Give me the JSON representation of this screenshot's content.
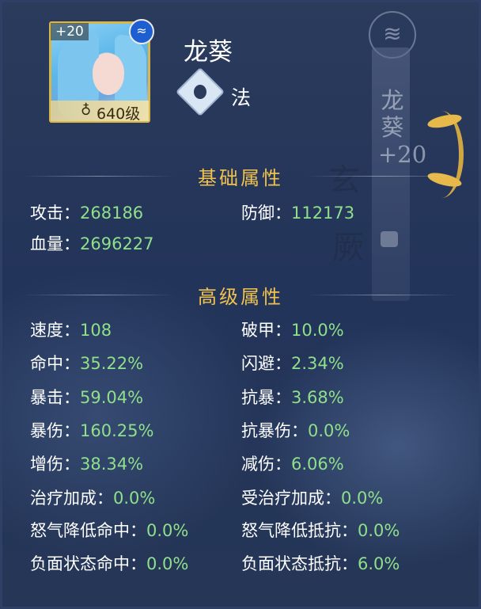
{
  "hero": {
    "name": "龙葵",
    "enhance": "+20",
    "level": "640级",
    "class_label": "法",
    "badge_icon": "wave-icon",
    "class_icon": "mage-diamond-icon"
  },
  "side": {
    "name_vertical": "龙葵+20"
  },
  "sections": {
    "basic_title": "基础属性",
    "advanced_title": "高级属性"
  },
  "basic_stats": [
    {
      "label": "攻击：",
      "value": "268186"
    },
    {
      "label": "防御：",
      "value": "112173"
    },
    {
      "label": "血量：",
      "value": "2696227"
    }
  ],
  "advanced_stats": [
    {
      "label": "速度：",
      "value": "108"
    },
    {
      "label": "破甲：",
      "value": "10.0%"
    },
    {
      "label": "命中：",
      "value": "35.22%"
    },
    {
      "label": "闪避：",
      "value": "2.34%"
    },
    {
      "label": "暴击：",
      "value": "59.04%"
    },
    {
      "label": "抗暴：",
      "value": "3.68%"
    },
    {
      "label": "暴伤：",
      "value": "160.25%"
    },
    {
      "label": "抗暴伤：",
      "value": "0.0%"
    },
    {
      "label": "增伤：",
      "value": "38.34%"
    },
    {
      "label": "减伤：",
      "value": "6.06%"
    },
    {
      "label": "治疗加成：",
      "value": "0.0%"
    },
    {
      "label": "受治疗加成：",
      "value": "0.0%"
    },
    {
      "label": "怒气降低命中：",
      "value": "0.0%"
    },
    {
      "label": "怒气降低抵抗：",
      "value": "0.0%"
    },
    {
      "label": "负面状态命中：",
      "value": "0.0%"
    },
    {
      "label": "负面状态抵抗：",
      "value": "6.0%"
    }
  ],
  "colors": {
    "label": "#ffffff",
    "value": "#8ee08a",
    "section_title": "#f0c24c"
  }
}
